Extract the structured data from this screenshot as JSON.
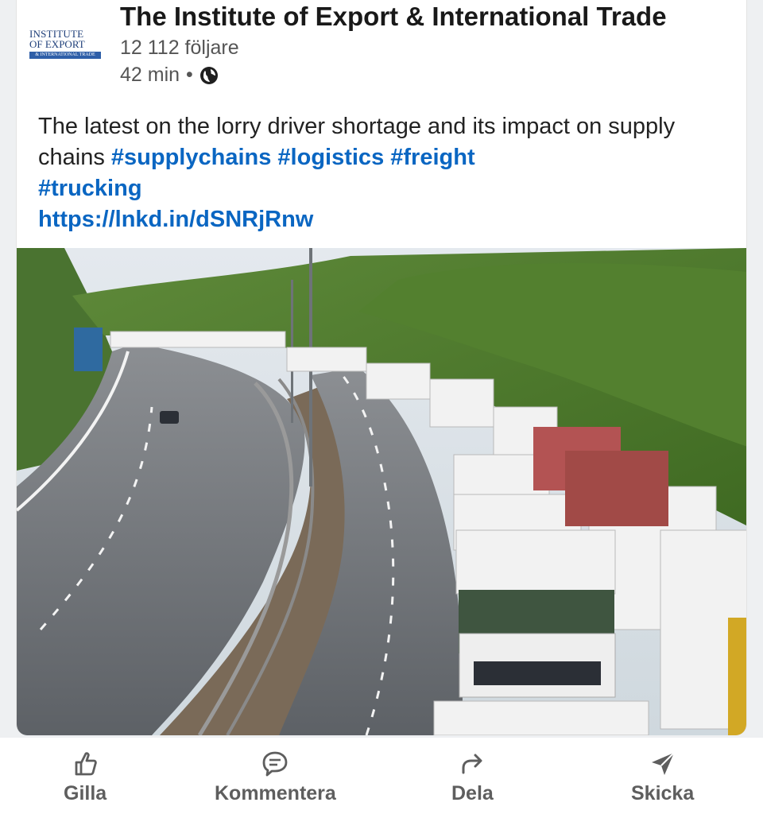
{
  "post": {
    "author": {
      "name": "The Institute of Export & International Trade",
      "followers": "12 112 följare",
      "time": "42 min",
      "separator": "•",
      "visibility_icon": "globe-icon",
      "logo_text": {
        "line1": "INSTITUTE",
        "line2": "OF EXPORT",
        "line3": "& INTERNATIONAL TRADE"
      }
    },
    "text": "The latest on the lorry driver shortage and its impact on supply chains",
    "hashtags": [
      "#supplychains",
      "#logistics",
      "#freight",
      "#trucking"
    ],
    "link": "https://lnkd.in/dSNRjRnw",
    "image_icon": "photo-motorway-lorry-queue"
  },
  "actions": [
    {
      "label": "Gilla",
      "icon": "thumbs-up-icon"
    },
    {
      "label": "Kommentera",
      "icon": "comment-icon"
    },
    {
      "label": "Dela",
      "icon": "share-arrow-icon"
    },
    {
      "label": "Skicka",
      "icon": "send-icon"
    }
  ],
  "colors": {
    "link": "#0a66c2",
    "text": "#191919",
    "muted": "#5e5e5e",
    "background": "#eef0f2"
  }
}
